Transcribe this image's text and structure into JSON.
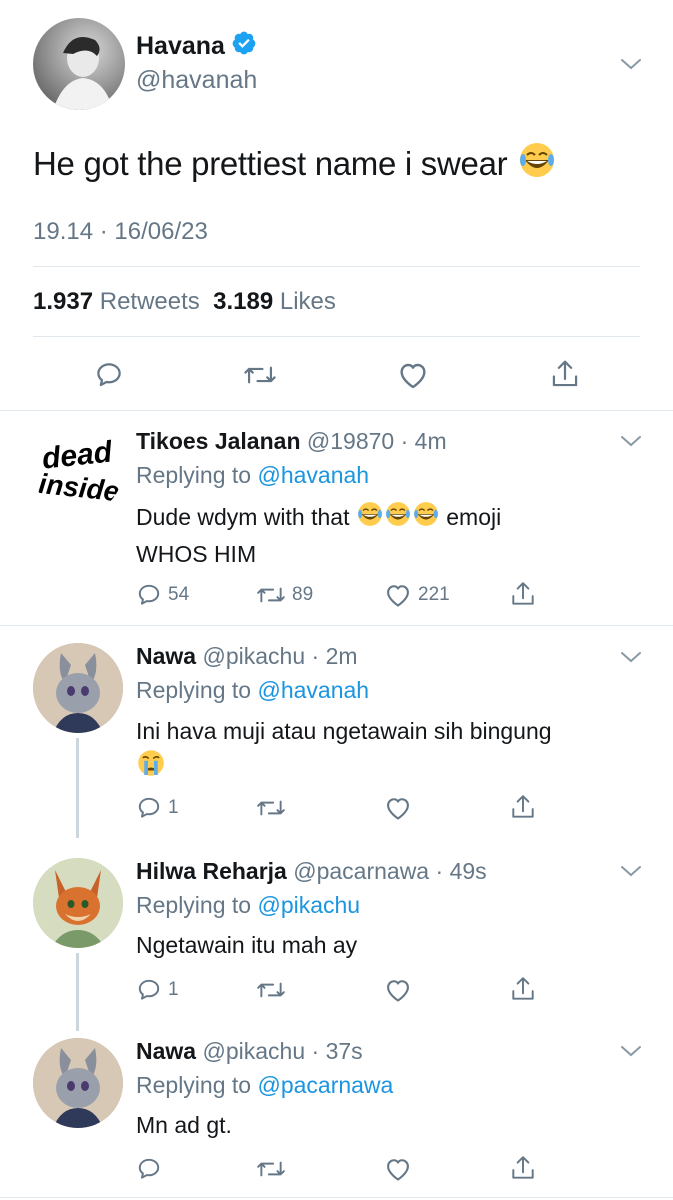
{
  "main_tweet": {
    "name": "Havana",
    "handle": "@havanah",
    "text": "He got the prettiest name i swear",
    "emoji": "joy-emoji",
    "timestamp": "19.14 · 16/06/23",
    "retweets_count": "1.937",
    "retweets_label": "Retweets",
    "likes_count": "3.189",
    "likes_label": "Likes"
  },
  "replies": [
    {
      "name": "Tikoes Jalanan",
      "handle": "@19870",
      "time": "4m",
      "replying_prefix": "Replying to",
      "replying_to": "@havanah",
      "text_before": "Dude wdym with that",
      "text_after": "emoji",
      "text_line2": "WHOS HIM",
      "avatar_text_1": "dead",
      "avatar_text_2": "inside",
      "reply_count": "54",
      "retweet_count": "89",
      "like_count": "221"
    },
    {
      "name": "Nawa",
      "handle": "@pikachu",
      "time": "2m",
      "replying_prefix": "Replying to",
      "replying_to": "@havanah",
      "text": "Ini hava muji atau ngetawain sih bingung",
      "reply_count": "1"
    },
    {
      "name": "Hilwa Reharja",
      "handle": "@pacarnawa",
      "time": "49s",
      "replying_prefix": "Replying to",
      "replying_to": "@pikachu",
      "text": "Ngetawain itu mah ay",
      "reply_count": "1"
    },
    {
      "name": "Nawa",
      "handle": "@pikachu",
      "time": "37s",
      "replying_prefix": "Replying to",
      "replying_to": "@pacarnawa",
      "text": "Mn ad gt."
    }
  ],
  "colors": {
    "link": "#1b95e0",
    "muted": "#657786",
    "verified": "#1da1f2",
    "divider": "#e1e8ed"
  }
}
